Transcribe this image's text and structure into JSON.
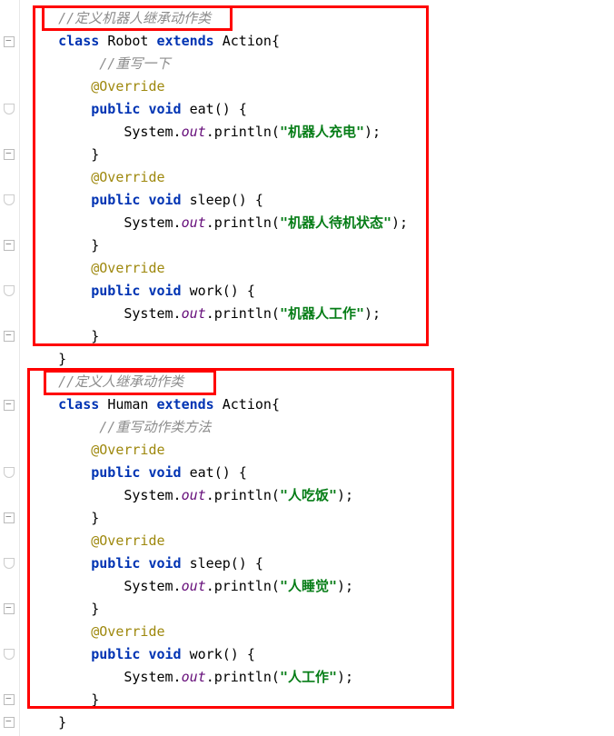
{
  "code": {
    "robot": {
      "comment": "//定义机器人继承动作类",
      "classLine": {
        "kw1": "class",
        "name": "Robot",
        "kw2": "extends",
        "parent": "Action",
        "brace": "{"
      },
      "innerComment": "//重写一下",
      "override": "@Override",
      "eat": {
        "kw1": "public",
        "kw2": "void",
        "name": "eat()",
        "brace": "{",
        "body": {
          "sys": "System.",
          "out": "out",
          "call1": ".println(",
          "str": "\"机器人充电\"",
          "call2": ");"
        },
        "close": "}"
      },
      "sleep": {
        "kw1": "public",
        "kw2": "void",
        "name": "sleep()",
        "brace": "{",
        "body": {
          "sys": "System.",
          "out": "out",
          "call1": ".println(",
          "str": "\"机器人待机状态\"",
          "call2": ");"
        },
        "close": "}"
      },
      "work": {
        "kw1": "public",
        "kw2": "void",
        "name": "work()",
        "brace": "{",
        "body": {
          "sys": "System.",
          "out": "out",
          "call1": ".println(",
          "str": "\"机器人工作\"",
          "call2": ");"
        },
        "close": "}"
      },
      "classClose": "}"
    },
    "human": {
      "comment": "//定义人继承动作类",
      "classLine": {
        "kw1": "class",
        "name": "Human",
        "kw2": "extends",
        "parent": "Action",
        "brace": "{"
      },
      "innerComment": "//重写动作类方法",
      "override": "@Override",
      "eat": {
        "kw1": "public",
        "kw2": "void",
        "name": "eat()",
        "brace": "{",
        "body": {
          "sys": "System.",
          "out": "out",
          "call1": ".println(",
          "str": "\"人吃饭\"",
          "call2": ");"
        },
        "close": "}"
      },
      "sleep": {
        "kw1": "public",
        "kw2": "void",
        "name": "sleep()",
        "brace": "{",
        "body": {
          "sys": "System.",
          "out": "out",
          "call1": ".println(",
          "str": "\"人睡觉\"",
          "call2": ");"
        },
        "close": "}"
      },
      "work": {
        "kw1": "public",
        "kw2": "void",
        "name": "work()",
        "brace": "{",
        "body": {
          "sys": "System.",
          "out": "out",
          "call1": ".println(",
          "str": "\"人工作\"",
          "call2": ");"
        },
        "close": "}"
      },
      "classClose": "}"
    }
  }
}
